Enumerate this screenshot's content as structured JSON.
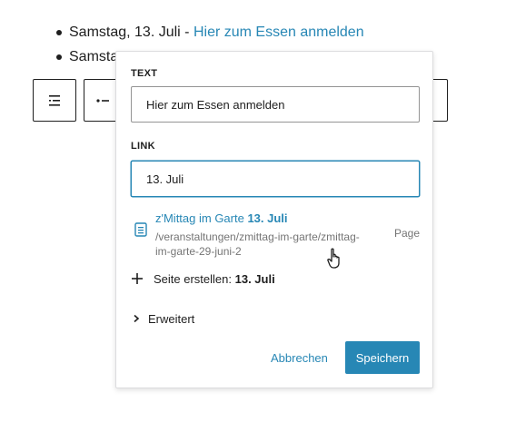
{
  "list": {
    "item1_text": "Samstag, 13. Juli - ",
    "item1_link": "Hier zum Essen anmelden",
    "item2_text": "Samsta"
  },
  "popover": {
    "text_label": "TEXT",
    "text_value": "Hier zum Essen anmelden",
    "link_label": "LINK",
    "link_value": "13. Juli",
    "suggestion": {
      "title_prefix": "z'Mittag im Garte ",
      "title_match": "13. Juli",
      "url": "/veranstaltungen/zmittag-im-garte/zmittag-im-garte-29-juni-2",
      "type": "Page",
      "icon": "page-icon"
    },
    "create_prefix": "Seite erstellen: ",
    "create_match": "13. Juli",
    "advanced_label": "Erweitert",
    "cancel_label": "Abbrechen",
    "save_label": "Speichern"
  },
  "colors": {
    "accent": "#2787b5",
    "text": "#1e1e1e",
    "muted": "#757575",
    "border": "#949494"
  }
}
